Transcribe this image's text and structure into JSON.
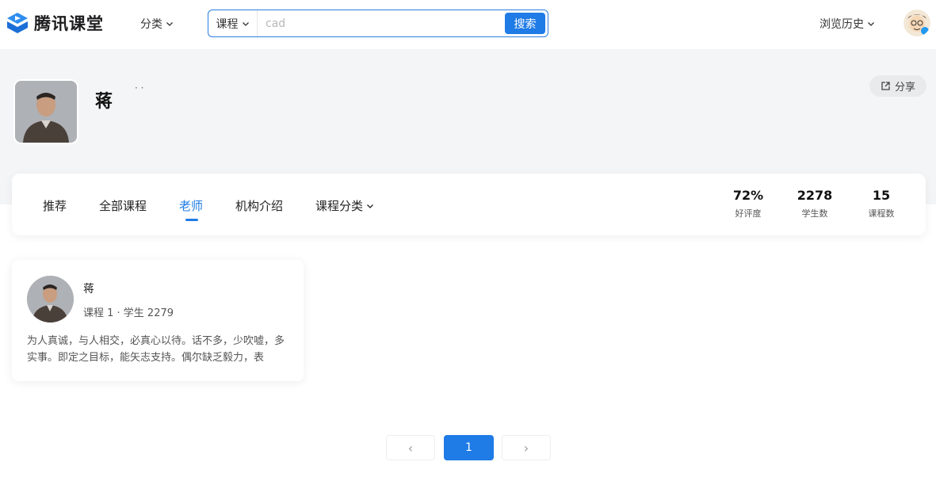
{
  "header": {
    "logo_text": "腾讯课堂",
    "category_label": "分类",
    "search": {
      "type_label": "课程",
      "placeholder": "cad",
      "button_label": "搜索"
    },
    "history_label": "浏览历史"
  },
  "org": {
    "name": "蒋",
    "dots": "· ·",
    "share_label": "分享"
  },
  "tabs": [
    {
      "label": "推荐",
      "active": false
    },
    {
      "label": "全部课程",
      "active": false
    },
    {
      "label": "老师",
      "active": true
    },
    {
      "label": "机构介绍",
      "active": false
    },
    {
      "label": "课程分类",
      "active": false
    }
  ],
  "stats": [
    {
      "value": "72%",
      "label": "好评度"
    },
    {
      "value": "2278",
      "label": "学生数"
    },
    {
      "value": "15",
      "label": "课程数"
    }
  ],
  "teacher": {
    "name": "蒋",
    "meta": "课程 1 · 学生 2279",
    "description": "为人真诚，与人相交，必真心以待。话不多，少吹嘘，多实事。即定之目标，能矢志支持。偶尔缺乏毅力，表"
  },
  "pagination": {
    "prev": "‹",
    "current": "1",
    "next": "›"
  },
  "colors": {
    "accent": "#1f7be6",
    "band": "#f4f5f7"
  }
}
